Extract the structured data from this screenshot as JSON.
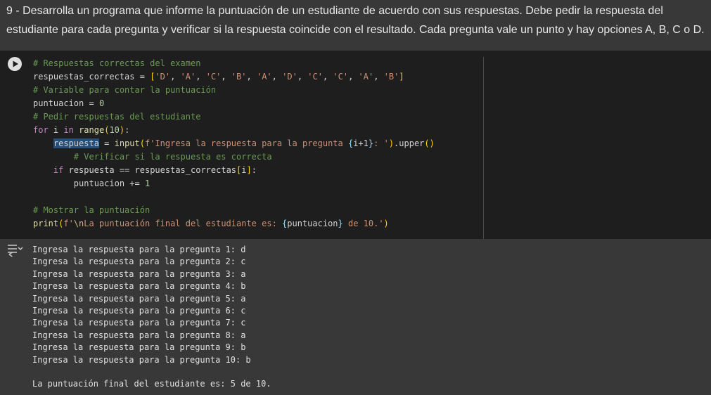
{
  "text_cell": {
    "paragraph": "9 - Desarrolla un programa que informe la puntuación de un estudiante de acuerdo con sus respuestas. Debe pedir la respuesta del estudiante para cada pregunta y verificar si la respuesta coincide con el resultado. Cada pregunta vale un punto y hay opciones A, B, C o D."
  },
  "code_cell": {
    "run_icon": "play-icon",
    "code": {
      "comment1": "# Respuestas correctas del examen",
      "var_respuestas": "respuestas_correctas",
      "list_items": [
        "'D'",
        "'A'",
        "'C'",
        "'B'",
        "'A'",
        "'D'",
        "'C'",
        "'C'",
        "'A'",
        "'B'"
      ],
      "comment2": "# Variable para contar la puntuación",
      "var_puntuacion": "puntuacion",
      "zero": "0",
      "comment3": "# Pedir respuestas del estudiante",
      "kw_for": "for",
      "loop_var": "i",
      "kw_in": "in",
      "fn_range": "range",
      "ten": "10",
      "var_respuesta": "respuesta",
      "fn_input": "input",
      "prompt_prefix": "f'Ingresa la respuesta para la pregunta ",
      "prompt_expr": "i+1",
      "prompt_suffix": ": '",
      "method_upper": ".upper",
      "comment4": "# Verificar si la respuesta es correcta",
      "kw_if": "if",
      "index_var": "i",
      "one": "1",
      "comment5": "# Mostrar la puntuación",
      "fn_print": "print",
      "final_prefix": "f'",
      "escape_nl": "\\n",
      "final_text": "La puntuación final del estudiante es: ",
      "final_expr": "puntuacion",
      "final_suffix": " de 10.'"
    }
  },
  "output": {
    "icon": "output-toggle-icon",
    "lines": [
      "Ingresa la respuesta para la pregunta 1: d",
      "Ingresa la respuesta para la pregunta 2: c",
      "Ingresa la respuesta para la pregunta 3: a",
      "Ingresa la respuesta para la pregunta 4: b",
      "Ingresa la respuesta para la pregunta 5: a",
      "Ingresa la respuesta para la pregunta 6: c",
      "Ingresa la respuesta para la pregunta 7: c",
      "Ingresa la respuesta para la pregunta 8: a",
      "Ingresa la respuesta para la pregunta 9: b",
      "Ingresa la respuesta para la pregunta 10: b",
      "",
      "La puntuación final del estudiante es: 5 de 10."
    ]
  },
  "colors": {
    "background": "#383838",
    "editor_bg": "#1e1e1e",
    "comment": "#6a9955",
    "string": "#ce9178",
    "keyword": "#c586c0",
    "function": "#dcdcaa"
  }
}
